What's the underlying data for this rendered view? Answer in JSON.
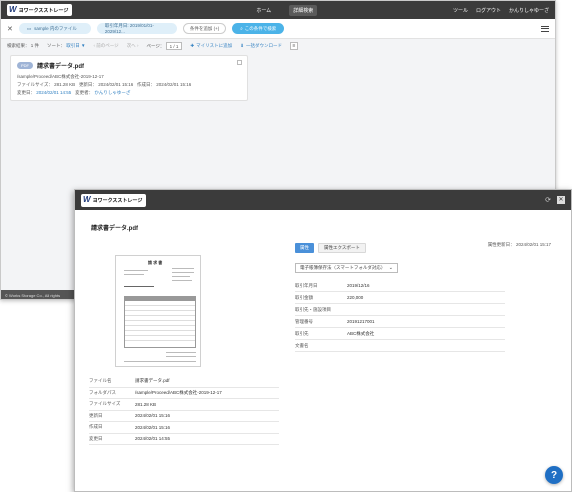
{
  "brand": {
    "logo_mark": "W",
    "logo_text": "ヨワークスストレージ"
  },
  "back": {
    "nav": [
      "ホーム",
      "詳細検索"
    ],
    "nav_right": [
      "ツール",
      "ログアウト",
      "かんりしゃゆーざ"
    ],
    "filters": {
      "folder_chip": "sample 内のファイル",
      "date_chip": "取引年月日: 2019/01/01-2029/12...",
      "add_condition": "条件を追加 (+)",
      "search_button": "この条件で検索"
    },
    "toolbar": {
      "result_label": "検索結果：",
      "result_count": "1 件",
      "sort_label": "ソート：",
      "sort_value": "取引日 ▼",
      "prev_page": "‹ 前のページ",
      "next_page": "次へ ›",
      "page_label": "ページ：",
      "page_value": "1 / 1",
      "add_mylist": "マイリストに追加",
      "bulk_download": "一括ダウンロード"
    },
    "result": {
      "badge": "PDF",
      "title": "請求書データ.pdf",
      "path": "/sample/Proceed/ABC株式会社-2019-12-17",
      "size_label": "ファイルサイズ：",
      "size_value": "281.28 KB",
      "updated_label": "更新日：",
      "updated_value": "2024/02/01 15:16",
      "created_label": "作成日：",
      "created_value": "2024/02/01 15:16",
      "modified_label": "変更日：",
      "modified_value": "2024/02/01 14:55",
      "modifier_label": "変更者：",
      "modifier_value": "かんりしゃゆーざ"
    },
    "footer": "© Works Storage Co., All rights"
  },
  "front": {
    "title": "請求書データ.pdf",
    "preview_title": "請 求 書",
    "tabs": {
      "active": "属性",
      "other": "属性エクスポート"
    },
    "updated_label": "属性更新日：",
    "updated_value": "2024/02/01 15:17",
    "select_value": "電子帳簿保存法（スマートフォルダ対応）",
    "attributes": [
      {
        "key": "取引年月日",
        "value": "2019/12/16"
      },
      {
        "key": "取引金額",
        "value": "220,000"
      },
      {
        "key": "取引先・施設項目",
        "value": ""
      },
      {
        "key": "管理番号",
        "value": "20191217001"
      },
      {
        "key": "取引先",
        "value": "ABC株式会社"
      },
      {
        "key": "文書名",
        "value": ""
      }
    ],
    "meta": [
      {
        "key": "ファイル名",
        "value": "請求書データ.pdf"
      },
      {
        "key": "フォルダパス",
        "value": "/sample/Proceed/ABC株式会社-2019-12-17"
      },
      {
        "key": "ファイルサイズ",
        "value": "281.28 KB"
      },
      {
        "key": "更新日",
        "value": "2024/02/01 15:16"
      },
      {
        "key": "作成日",
        "value": "2024/02/01 15:16"
      },
      {
        "key": "変更日",
        "value": "2024/02/01 14:55"
      }
    ],
    "help_label": "?"
  }
}
